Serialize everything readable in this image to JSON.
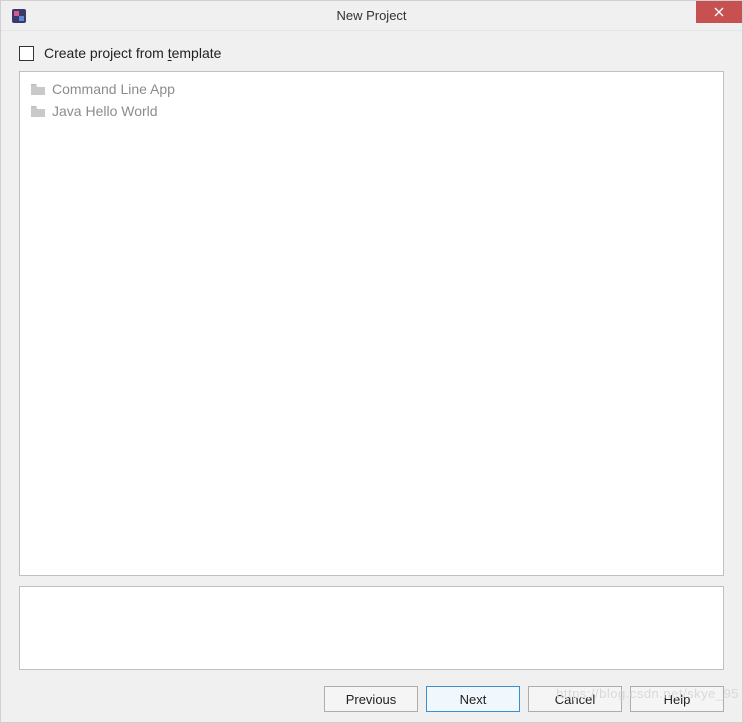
{
  "window": {
    "title": "New Project"
  },
  "checkbox": {
    "label_pre": "Create project from ",
    "label_mnemonic": "t",
    "label_post": "emplate",
    "checked": false
  },
  "templates": [
    {
      "label": "Command Line App"
    },
    {
      "label": "Java Hello World"
    }
  ],
  "buttons": {
    "previous": "Previous",
    "next": "Next",
    "cancel": "Cancel",
    "help": "Help"
  },
  "watermark": "https://blog.csdn.net/skye_95"
}
